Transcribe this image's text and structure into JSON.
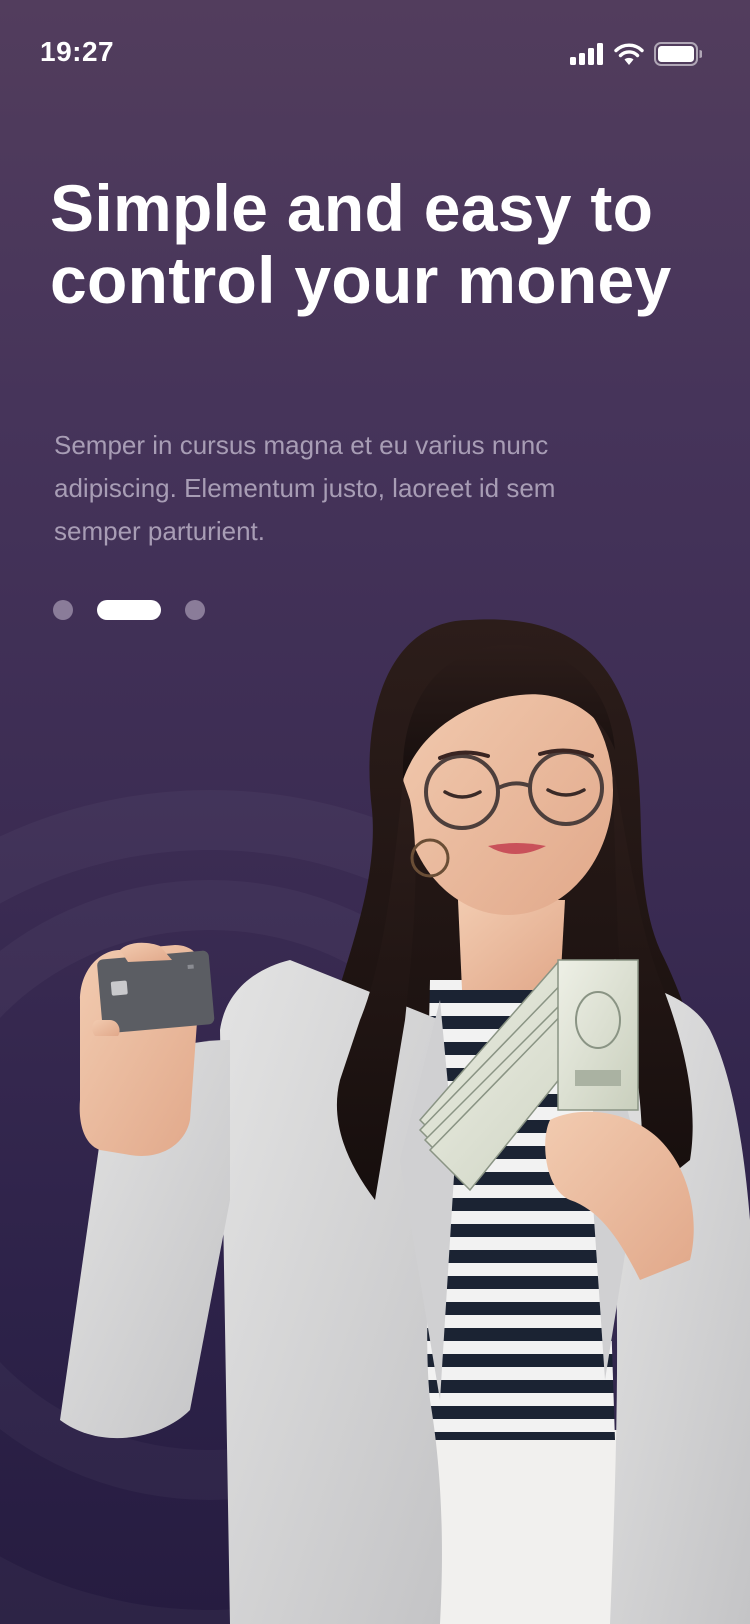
{
  "status_bar": {
    "time": "19:27",
    "signal_icon": "cellular-signal-icon",
    "wifi_icon": "wifi-icon",
    "battery_icon": "battery-icon"
  },
  "onboarding": {
    "title": "Simple and easy to control your money",
    "description": "Semper in cursus magna et eu varius nunc adipiscing. Elementum justo, laoreet id sem semper parturient.",
    "pager": {
      "total": 3,
      "active_index": 1
    }
  },
  "colors": {
    "background_top": "#523d5d",
    "background_bottom": "#261c40",
    "title": "#ffffff",
    "description": "#a89db5",
    "dot_inactive": "#8a7c99",
    "dot_active": "#ffffff"
  },
  "illustration": {
    "subject": "woman-holding-card-and-cash-image"
  }
}
